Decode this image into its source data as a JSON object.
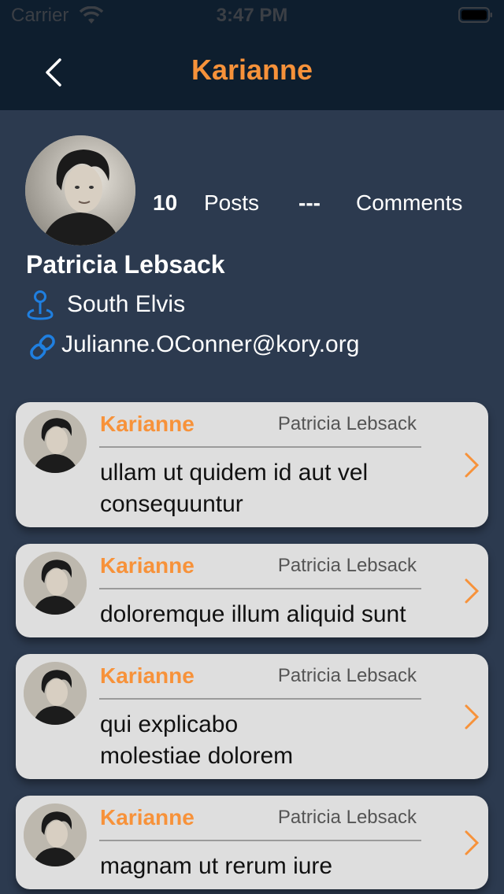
{
  "status_bar": {
    "carrier": "Carrier",
    "time": "3:47 PM"
  },
  "nav": {
    "title": "Karianne"
  },
  "profile": {
    "posts_count": "10",
    "posts_label": "Posts",
    "comments_count": "---",
    "comments_label": "Comments",
    "name": "Patricia Lebsack",
    "location": "South Elvis",
    "email": "Julianne.OConner@kory.org"
  },
  "posts": [
    {
      "title": "Karianne",
      "author": "Patricia Lebsack",
      "body": "ullam ut quidem id aut vel consequuntur"
    },
    {
      "title": "Karianne",
      "author": "Patricia Lebsack",
      "body": "doloremque illum aliquid sunt"
    },
    {
      "title": "Karianne",
      "author": "Patricia Lebsack",
      "body": "qui explicabo molestiae dolorem"
    },
    {
      "title": "Karianne",
      "author": "Patricia Lebsack",
      "body": "magnam ut rerum iure"
    }
  ],
  "colors": {
    "accent": "#f7923a",
    "nav_bg": "#0e1e2e",
    "page_bg": "#2c3a4f",
    "card_bg": "#dedede",
    "icon_blue": "#1f7fe0"
  },
  "icons": {
    "back": "chevron-left-icon",
    "location": "map-pin-icon",
    "link": "link-icon",
    "row_action": "chevron-right-icon"
  }
}
